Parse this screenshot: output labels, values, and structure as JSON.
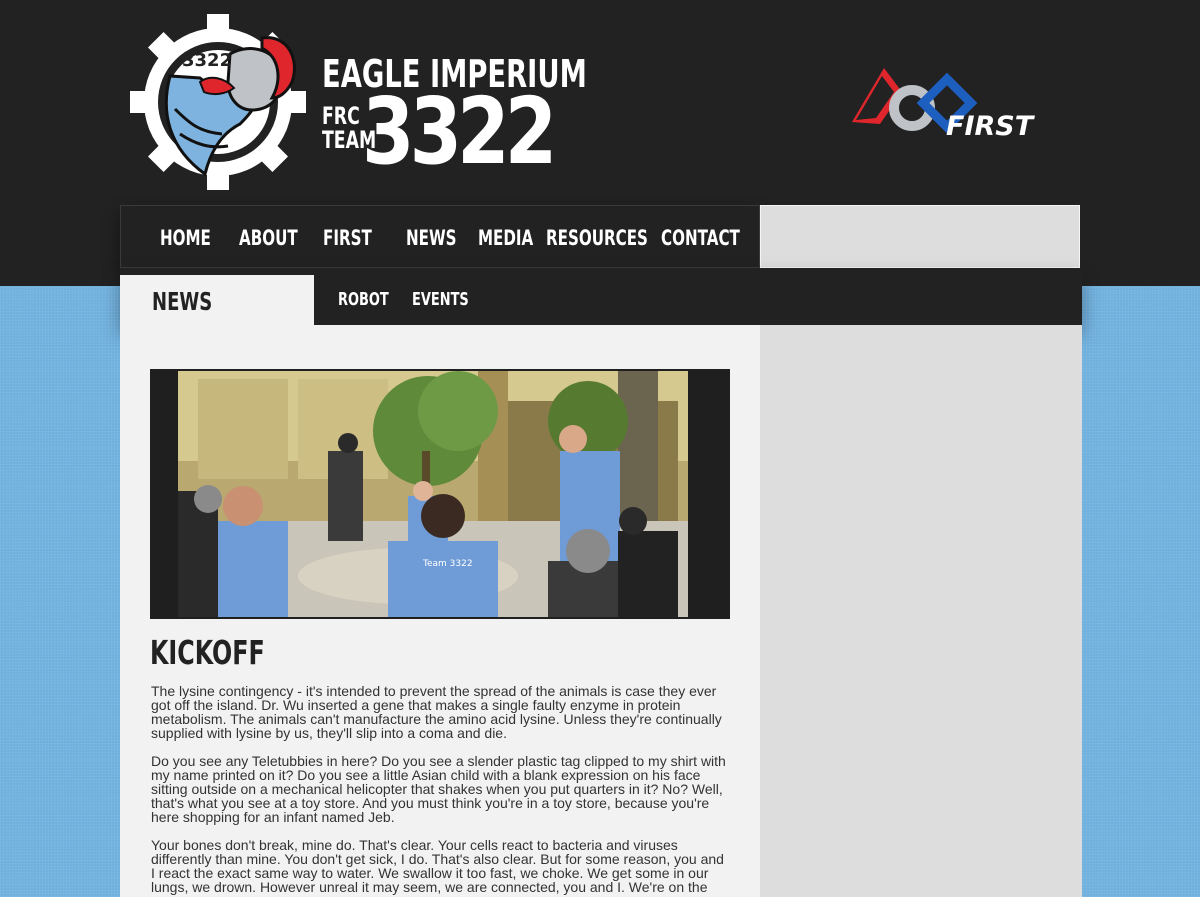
{
  "header": {
    "brand_title": "EAGLE IMPERIUM",
    "frc_line1": "FRC",
    "frc_line2": "TEAM",
    "team_number": "3322",
    "logo_badge": "3322",
    "first_logo_text": "FIRST"
  },
  "nav": {
    "items": [
      "HOME",
      "ABOUT",
      "FIRST",
      "NEWS",
      "MEDIA",
      "RESOURCES",
      "CONTACT"
    ]
  },
  "subnav": {
    "active": "NEWS",
    "items": [
      "ROBOT",
      "EVENTS"
    ]
  },
  "article": {
    "title": "KICKOFF",
    "paragraphs": [
      "The lysine contingency - it's intended to prevent the spread of the animals is case they ever got off the island. Dr. Wu inserted a gene that makes a single faulty enzyme in protein metabolism. The animals can't manufacture the amino acid lysine. Unless they're continually supplied with lysine by us, they'll slip into a coma and die.",
      "Do you see any Teletubbies in here? Do you see a slender plastic tag clipped to my shirt with my name printed on it? Do you see a little Asian child with a blank expression on his face sitting outside on a mechanical helicopter that shakes when you put quarters in it? No? Well, that's what you see at a toy store. And you must think you're in a toy store, because you're here shopping for an infant named Jeb.",
      "Your bones don't break, mine do. That's clear. Your cells react to bacteria and viruses differently than mine. You don't get sick, I do. That's also clear. But for some reason, you and I react the exact same way to water. We swallow it too fast, we choke. We get some in our lungs, we drown. However unreal it may seem, we are connected, you and I. We're on the"
    ],
    "photo_shirt_text": "Team 3322"
  },
  "colors": {
    "background_blue": "#6fb0de",
    "dark_band": "#222222",
    "content_bg": "#f2f2f2",
    "sidebar_bg": "#dddddd",
    "logo_blue": "#7fb3df",
    "logo_red": "#e0262d",
    "first_blue": "#1c5fbf"
  },
  "icons": [
    "team-logo-icon",
    "first-logo-icon"
  ]
}
